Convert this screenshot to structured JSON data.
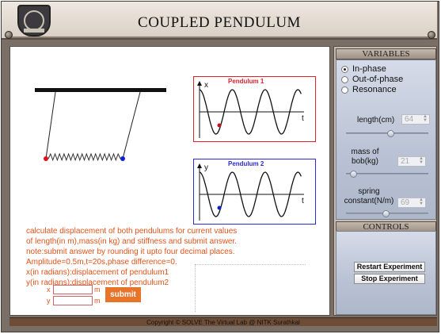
{
  "header": {
    "title": "COUPLED PENDULUM"
  },
  "graphs": {
    "top": {
      "label": "Pendulum 1",
      "y_axis": "x",
      "x_axis": "t",
      "color": "#e0202a"
    },
    "bottom": {
      "label": "Pendulum 2",
      "y_axis": "y",
      "x_axis": "t",
      "color": "#2a2ad8"
    }
  },
  "question": {
    "lines": [
      "calculate displacement of both pendulums for current values",
      "of length(in m),mass(in kg) and stiffness and submit answer.",
      "note:submit answer by rounding it upto four decimal places.",
      "Amplitude=0.5m,t=20s,phase difference=0.",
      "x(in radians):displacement of pendulum1",
      "y(in radians):displacement of pendulum2"
    ],
    "x_label": "x",
    "y_label": "y",
    "unit": "m",
    "submit_label": "submit",
    "x_value": "",
    "y_value": ""
  },
  "variables": {
    "heading": "VARIABLES",
    "modes": [
      {
        "label": "In-phase",
        "selected": true
      },
      {
        "label": "Out-of-phase",
        "selected": false
      },
      {
        "label": "Resonance",
        "selected": false
      }
    ],
    "length": {
      "label": "length(cm)",
      "value": "64",
      "level": 0.55
    },
    "mass": {
      "label": "mass of bob(kg)",
      "value": "21",
      "level": 0.05
    },
    "spring": {
      "label": "spring constant(N/m)",
      "value": "69",
      "level": 0.48
    }
  },
  "controls": {
    "heading": "CONTROLS",
    "restart_label": "Restart Experiment",
    "stop_label": "Stop Experiment"
  },
  "footer": {
    "text": "Copyright © SOLVE The Virtual Lab @ NITK Surathkal"
  }
}
